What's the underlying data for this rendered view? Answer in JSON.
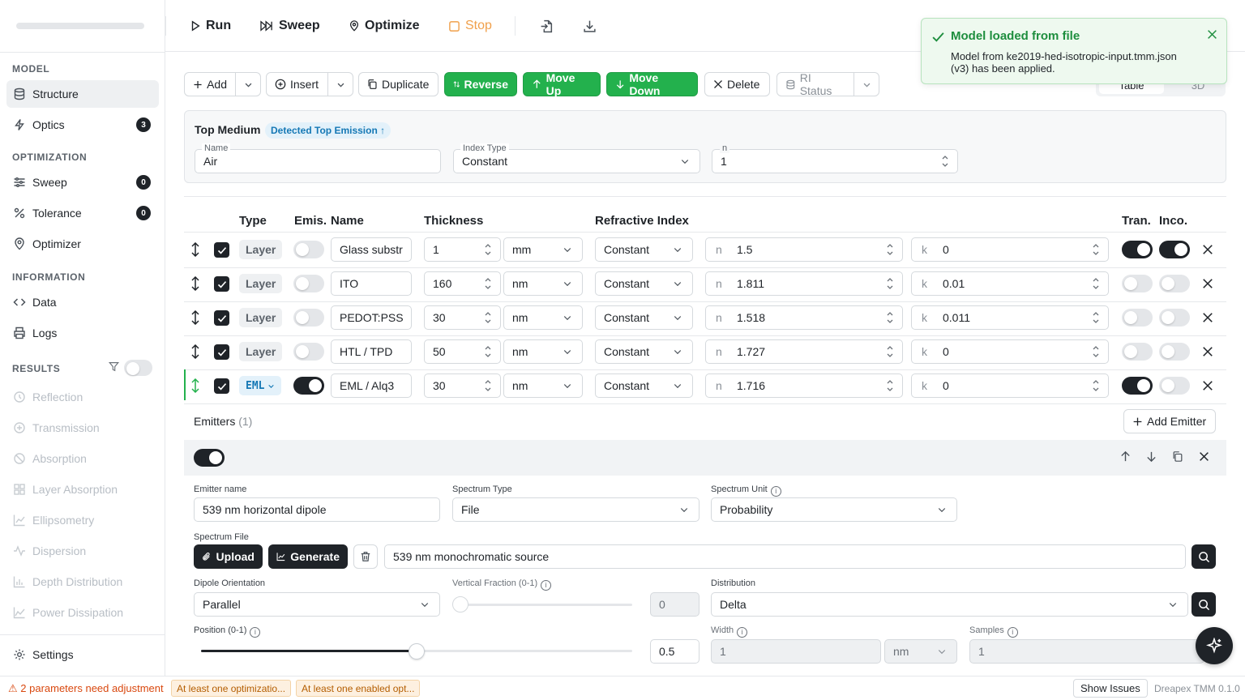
{
  "sidebar": {
    "sections": {
      "model": "MODEL",
      "optimization": "OPTIMIZATION",
      "information": "INFORMATION",
      "results": "RESULTS"
    },
    "items": {
      "structure": "Structure",
      "optics": "Optics",
      "sweep": "Sweep",
      "tolerance": "Tolerance",
      "optimizer": "Optimizer",
      "data": "Data",
      "logs": "Logs",
      "settings": "Settings"
    },
    "badges": {
      "optics": "3",
      "sweep": "0",
      "tolerance": "0"
    },
    "results": [
      "Reflection",
      "Transmission",
      "Absorption",
      "Layer Absorption",
      "Ellipsometry",
      "Dispersion",
      "Depth Distribution",
      "Power Dissipation"
    ]
  },
  "toolbar": {
    "run": "Run",
    "sweep": "Sweep",
    "optimize": "Optimize",
    "stop": "Stop"
  },
  "actions": {
    "add": "Add",
    "insert": "Insert",
    "duplicate": "Duplicate",
    "reverse": "Reverse",
    "move_up": "Move Up",
    "move_down": "Move Down",
    "delete": "Delete",
    "ri_status": "RI Status",
    "view_table": "Table",
    "view_3d": "3D"
  },
  "top_medium": {
    "title": "Top Medium",
    "badge": "Detected Top Emission ↑",
    "name_label": "Name",
    "name_value": "Air",
    "index_type_label": "Index Type",
    "index_type_value": "Constant",
    "n_label": "n",
    "n_value": "1"
  },
  "table": {
    "headers": {
      "type": "Type",
      "emis": "Emis.",
      "name": "Name",
      "thickness": "Thickness",
      "ri": "Refractive Index",
      "tran": "Tran.",
      "inco": "Inco."
    },
    "rows": [
      {
        "type": "Layer",
        "name": "Glass substr",
        "thickness": "1",
        "unit": "mm",
        "index_type": "Constant",
        "n_prefix": "n",
        "n": "1.5",
        "k_prefix": "k",
        "k": "0"
      },
      {
        "type": "Layer",
        "name": "ITO",
        "thickness": "160",
        "unit": "nm",
        "index_type": "Constant",
        "n_prefix": "n",
        "n": "1.811",
        "k_prefix": "k",
        "k": "0.01"
      },
      {
        "type": "Layer",
        "name": "PEDOT:PSS",
        "thickness": "30",
        "unit": "nm",
        "index_type": "Constant",
        "n_prefix": "n",
        "n": "1.518",
        "k_prefix": "k",
        "k": "0.011"
      },
      {
        "type": "Layer",
        "name": "HTL / TPD",
        "thickness": "50",
        "unit": "nm",
        "index_type": "Constant",
        "n_prefix": "n",
        "n": "1.727",
        "k_prefix": "k",
        "k": "0"
      },
      {
        "type": "EML",
        "name": "EML / Alq3",
        "thickness": "30",
        "unit": "nm",
        "index_type": "Constant",
        "n_prefix": "n",
        "n": "1.716",
        "k_prefix": "k",
        "k": "0"
      }
    ],
    "toggles": {
      "emis": [
        false,
        false,
        false,
        false,
        true
      ],
      "tran": [
        true,
        false,
        false,
        false,
        true
      ],
      "inco": [
        true,
        false,
        false,
        false,
        false
      ]
    }
  },
  "emitters": {
    "title": "Emitters",
    "count": "(1)",
    "add": "Add Emitter",
    "name_label": "Emitter name",
    "name_value": "539 nm horizontal dipole",
    "spectrum_type_label": "Spectrum Type",
    "spectrum_type_value": "File",
    "spectrum_unit_label": "Spectrum Unit",
    "spectrum_unit_value": "Probability",
    "spectrum_file_label": "Spectrum File",
    "upload": "Upload",
    "generate": "Generate",
    "spectrum_file_value": "539 nm monochromatic source",
    "dipole_label": "Dipole Orientation",
    "dipole_value": "Parallel",
    "vfrac_label": "Vertical Fraction (0-1)",
    "vfrac_value": "0",
    "distribution_label": "Distribution",
    "distribution_value": "Delta",
    "position_label": "Position (0-1)",
    "position_value": "0.5",
    "width_label": "Width",
    "width_value": "1",
    "width_unit": "nm",
    "samples_label": "Samples",
    "samples_value": "1"
  },
  "toast": {
    "title": "Model loaded from file",
    "message": "Model from ke2019-hed-isotropic-input.tmm.json (v3) has been applied."
  },
  "status": {
    "warning": "⚠ 2 parameters need adjustment",
    "chip1": "At least one optimizatio...",
    "chip2": "At least one enabled opt...",
    "show_issues": "Show Issues",
    "version": "Dreapex TMM 0.1.0"
  },
  "colors": {
    "accent_green": "#23b14d",
    "dark": "#1f2328",
    "stop_orange": "#f0a04b",
    "info_blue": "#1578b5"
  }
}
